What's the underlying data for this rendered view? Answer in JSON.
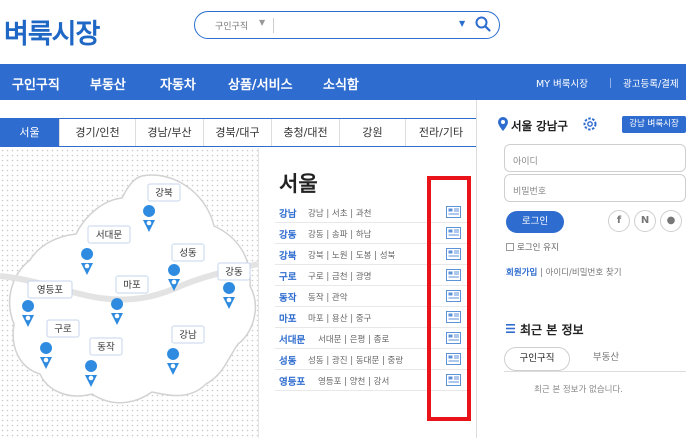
{
  "header": {
    "logo": "벼룩시장",
    "search": {
      "category": "구인구직",
      "placeholder": ""
    }
  },
  "nav": {
    "items": [
      "구인구직",
      "부동산",
      "자동차",
      "상품/서비스",
      "소식함"
    ],
    "right": [
      "MY 벼룩시장",
      "광고등록/결제"
    ]
  },
  "region_tabs": [
    "서울",
    "경기/인천",
    "경남/부산",
    "경북/대구",
    "충청/대전",
    "강원",
    "전라/기타"
  ],
  "map": {
    "labels": [
      "강북",
      "서대문",
      "성동",
      "강동",
      "영등포",
      "마포",
      "구로",
      "강남",
      "동작"
    ]
  },
  "list": {
    "title": "서울",
    "rows": [
      {
        "district": "강남",
        "subs": "강남 | 서초 | 과천"
      },
      {
        "district": "강동",
        "subs": "강동 | 송파 | 하남"
      },
      {
        "district": "강북",
        "subs": "강북 | 노원 | 도봉 | 성북"
      },
      {
        "district": "구로",
        "subs": "구로 | 금천 | 광명"
      },
      {
        "district": "동작",
        "subs": "동작 | 관악"
      },
      {
        "district": "마포",
        "subs": "마포 | 용산 | 중구"
      },
      {
        "district": "서대문",
        "subs": "서대문 | 은평 | 종로"
      },
      {
        "district": "성동",
        "subs": "성동 | 광진 | 동대문 | 중랑"
      },
      {
        "district": "영등포",
        "subs": "영등포 | 양천 | 강서"
      }
    ]
  },
  "sidebar": {
    "location": "서울 강남구",
    "region_button": "강남 벼룩시장",
    "id_placeholder": "아이디",
    "pw_placeholder": "비밀번호",
    "login_button": "로그인",
    "social": [
      "f",
      "N",
      "●"
    ],
    "keep_login": "로그인 유지",
    "signup": "회원가입",
    "find": "아이디/비밀번호 찾기",
    "recent_title": "최근 본 정보",
    "recent_tabs": [
      "구인구직",
      "부동산"
    ],
    "recent_empty": "최근 본 정보가 없습니다."
  },
  "colors": {
    "brand": "#2e6ccf",
    "highlight_box": "#e8141a"
  }
}
